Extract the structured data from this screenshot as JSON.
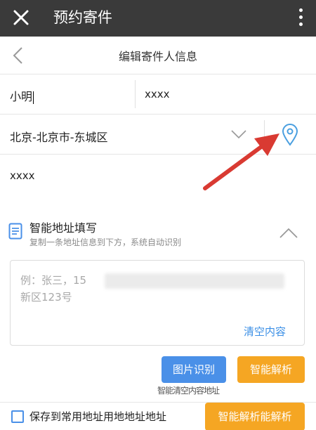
{
  "app_bar": {
    "title": "预约寄件"
  },
  "nav": {
    "title": "编辑寄件人信息"
  },
  "form": {
    "name": "小明",
    "phone": "xxxx",
    "region": "北京-北京市-东城区",
    "detail_address": "xxxx"
  },
  "smart_address": {
    "title": "智能地址填写",
    "subtitle": "复制一条地址信息到下方，系统自动识别",
    "placeholder_line1": "例：张三，15",
    "placeholder_line2": "新区123号",
    "clear_label": "清空内容",
    "image_recognition_label": "图片识别",
    "smart_parse_label": "智能解析",
    "overlap_text": "智能清空内容地址"
  },
  "bottom_bar": {
    "save_label": "保存到常用地址用地地址地址",
    "button_label": "智能解析能解析"
  },
  "colors": {
    "app_bar": "#3a3a3a",
    "accent_blue": "#4a90e8",
    "accent_orange": "#f5a623",
    "annotation_arrow": "#d93a32"
  },
  "icons": [
    "close-icon",
    "more-icon",
    "back-icon",
    "chevron-down-icon",
    "location-pin-icon",
    "document-icon",
    "chevron-up-icon",
    "red-arrow-annotation"
  ]
}
